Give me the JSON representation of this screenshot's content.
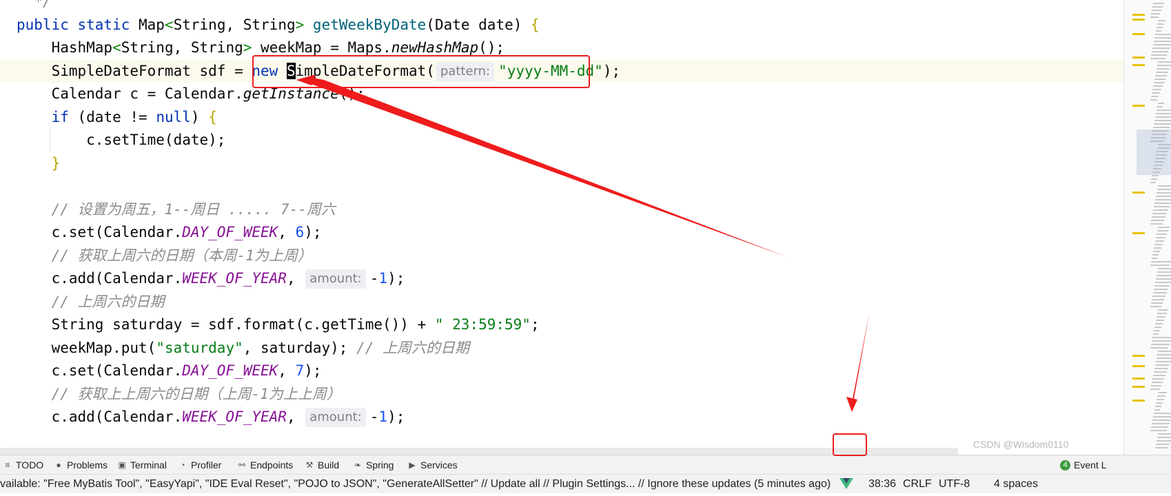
{
  "editor": {
    "lines": [
      {
        "name": "line-doc-end",
        "tokens": [
          {
            "t": "  */",
            "c": "comment"
          }
        ]
      },
      {
        "name": "line-method-signature",
        "tokens": [
          {
            "t": "public static ",
            "c": "kw"
          },
          {
            "t": "Map",
            "c": "type"
          },
          {
            "t": "<",
            "c": "gen"
          },
          {
            "t": "String, String",
            "c": "type"
          },
          {
            "t": "> ",
            "c": "gen"
          },
          {
            "t": "getWeekByDate",
            "c": "fn"
          },
          {
            "t": "(Date date) ",
            "c": "type"
          },
          {
            "t": "{",
            "c": "brace"
          }
        ]
      },
      {
        "name": "line-hashmap",
        "tokens": [
          {
            "t": "    HashMap",
            "c": "type"
          },
          {
            "t": "<",
            "c": "gen"
          },
          {
            "t": "String, String",
            "c": "type"
          },
          {
            "t": "> ",
            "c": "gen"
          },
          {
            "t": "weekMap = Maps.",
            "c": "type"
          },
          {
            "t": "newHashMap",
            "c": "it"
          },
          {
            "t": "();",
            "c": "type"
          }
        ]
      },
      {
        "name": "line-simpledateformat",
        "current": true,
        "tokens": [
          {
            "t": "    SimpleDateFormat sdf = ",
            "c": "type"
          },
          {
            "t": "new ",
            "c": "kw"
          },
          {
            "t": "S",
            "c": "cursor"
          },
          {
            "t": "impleDateFormat(",
            "c": "type"
          },
          {
            "t": "pattern:",
            "c": "hint"
          },
          {
            "t": "\"yyyy-MM-dd\"",
            "c": "str"
          },
          {
            "t": ");",
            "c": "type"
          }
        ]
      },
      {
        "name": "line-calendar",
        "tokens": [
          {
            "t": "    Calendar c = Calendar.",
            "c": "type"
          },
          {
            "t": "getInstance",
            "c": "it"
          },
          {
            "t": "();",
            "c": "type"
          }
        ]
      },
      {
        "name": "line-if",
        "tokens": [
          {
            "t": "    ",
            "c": "type"
          },
          {
            "t": "if ",
            "c": "kw"
          },
          {
            "t": "(date != ",
            "c": "type"
          },
          {
            "t": "null",
            "c": "kw"
          },
          {
            "t": ") ",
            "c": "type"
          },
          {
            "t": "{",
            "c": "brace"
          }
        ]
      },
      {
        "name": "line-settime",
        "tokens": [
          {
            "t": "        c.setTime(date);",
            "c": "type"
          }
        ]
      },
      {
        "name": "line-close-if",
        "tokens": [
          {
            "t": "    ",
            "c": "type"
          },
          {
            "t": "}",
            "c": "brace"
          }
        ]
      },
      {
        "name": "line-blank",
        "tokens": [
          {
            "t": "",
            "c": "type"
          }
        ]
      },
      {
        "name": "line-comment-1",
        "tokens": [
          {
            "t": "    // 设置为周五，1--周日 ..... 7--周六",
            "c": "comment"
          }
        ]
      },
      {
        "name": "line-set-dow-6",
        "tokens": [
          {
            "t": "    c.set(Calendar.",
            "c": "type"
          },
          {
            "t": "DAY_OF_WEEK",
            "c": "field"
          },
          {
            "t": ", ",
            "c": "type"
          },
          {
            "t": "6",
            "c": "num"
          },
          {
            "t": ");",
            "c": "type"
          }
        ]
      },
      {
        "name": "line-comment-2",
        "tokens": [
          {
            "t": "    // 获取上周六的日期（本周-1为上周）",
            "c": "comment"
          }
        ]
      },
      {
        "name": "line-add-woy",
        "tokens": [
          {
            "t": "    c.add(Calendar.",
            "c": "type"
          },
          {
            "t": "WEEK_OF_YEAR",
            "c": "field"
          },
          {
            "t": ", ",
            "c": "type"
          },
          {
            "t": "amount:",
            "c": "hint"
          },
          {
            "t": "-",
            "c": "type"
          },
          {
            "t": "1",
            "c": "num"
          },
          {
            "t": ");",
            "c": "type"
          }
        ]
      },
      {
        "name": "line-comment-3",
        "tokens": [
          {
            "t": "    // 上周六的日期",
            "c": "comment"
          }
        ]
      },
      {
        "name": "line-saturday",
        "tokens": [
          {
            "t": "    String saturday = sdf.format(c.getTime()) + ",
            "c": "type"
          },
          {
            "t": "\" 23:59:59\"",
            "c": "str"
          },
          {
            "t": ";",
            "c": "type"
          }
        ]
      },
      {
        "name": "line-put",
        "tokens": [
          {
            "t": "    weekMap.put(",
            "c": "type"
          },
          {
            "t": "\"saturday\"",
            "c": "str"
          },
          {
            "t": ", saturday); ",
            "c": "type"
          },
          {
            "t": "// 上周六的日期",
            "c": "comment"
          }
        ]
      },
      {
        "name": "line-set-dow-7",
        "tokens": [
          {
            "t": "    c.set(Calendar.",
            "c": "type"
          },
          {
            "t": "DAY_OF_WEEK",
            "c": "field"
          },
          {
            "t": ", ",
            "c": "type"
          },
          {
            "t": "7",
            "c": "num"
          },
          {
            "t": ");",
            "c": "type"
          }
        ]
      },
      {
        "name": "line-comment-4",
        "tokens": [
          {
            "t": "    // 获取上上周六的日期（上周-1为上上周）",
            "c": "comment"
          }
        ]
      },
      {
        "name": "line-add-woy-2",
        "tokens": [
          {
            "t": "    c.add(Calendar.",
            "c": "type"
          },
          {
            "t": "WEEK_OF_YEAR",
            "c": "field"
          },
          {
            "t": ", ",
            "c": "type"
          },
          {
            "t": "amount:",
            "c": "hint"
          },
          {
            "t": "-",
            "c": "type"
          },
          {
            "t": "1",
            "c": "num"
          },
          {
            "t": ");",
            "c": "type"
          }
        ]
      }
    ]
  },
  "tool_windows": [
    {
      "label": "TODO",
      "icon": "list-icon",
      "glyph": "≡"
    },
    {
      "label": "Problems",
      "icon": "problems-icon",
      "glyph": "●"
    },
    {
      "label": "Terminal",
      "icon": "terminal-icon",
      "glyph": "▣"
    },
    {
      "label": "Profiler",
      "icon": "profiler-icon",
      "glyph": "◔"
    },
    {
      "label": "Endpoints",
      "icon": "endpoints-icon",
      "glyph": "⚯"
    },
    {
      "label": "Build",
      "icon": "hammer-icon",
      "glyph": "⚒"
    },
    {
      "label": "Spring",
      "icon": "spring-leaf-icon",
      "glyph": "❧"
    },
    {
      "label": "Services",
      "icon": "services-icon",
      "glyph": "▶"
    }
  ],
  "event_log": {
    "badge": "4",
    "label": "Event L"
  },
  "status": {
    "message": "vailable: \"Free MyBatis Tool\", \"EasyYapi\", \"IDE Eval Reset\", \"POJO to JSON\", \"GenerateAllSetter\" // Update all // Plugin Settings... // Ignore these updates (5 minutes ago)",
    "vue_icon": "vue-icon",
    "position": "38:36",
    "line_separator": "CRLF",
    "encoding": "UTF-8",
    "indent": "4 spaces"
  },
  "watermark": "CSDN @Wisdom0110",
  "colors": {
    "annotation": "#ee1c1c",
    "keyword": "#0033b3",
    "string": "#067d17",
    "comment": "#8c8c8c"
  }
}
